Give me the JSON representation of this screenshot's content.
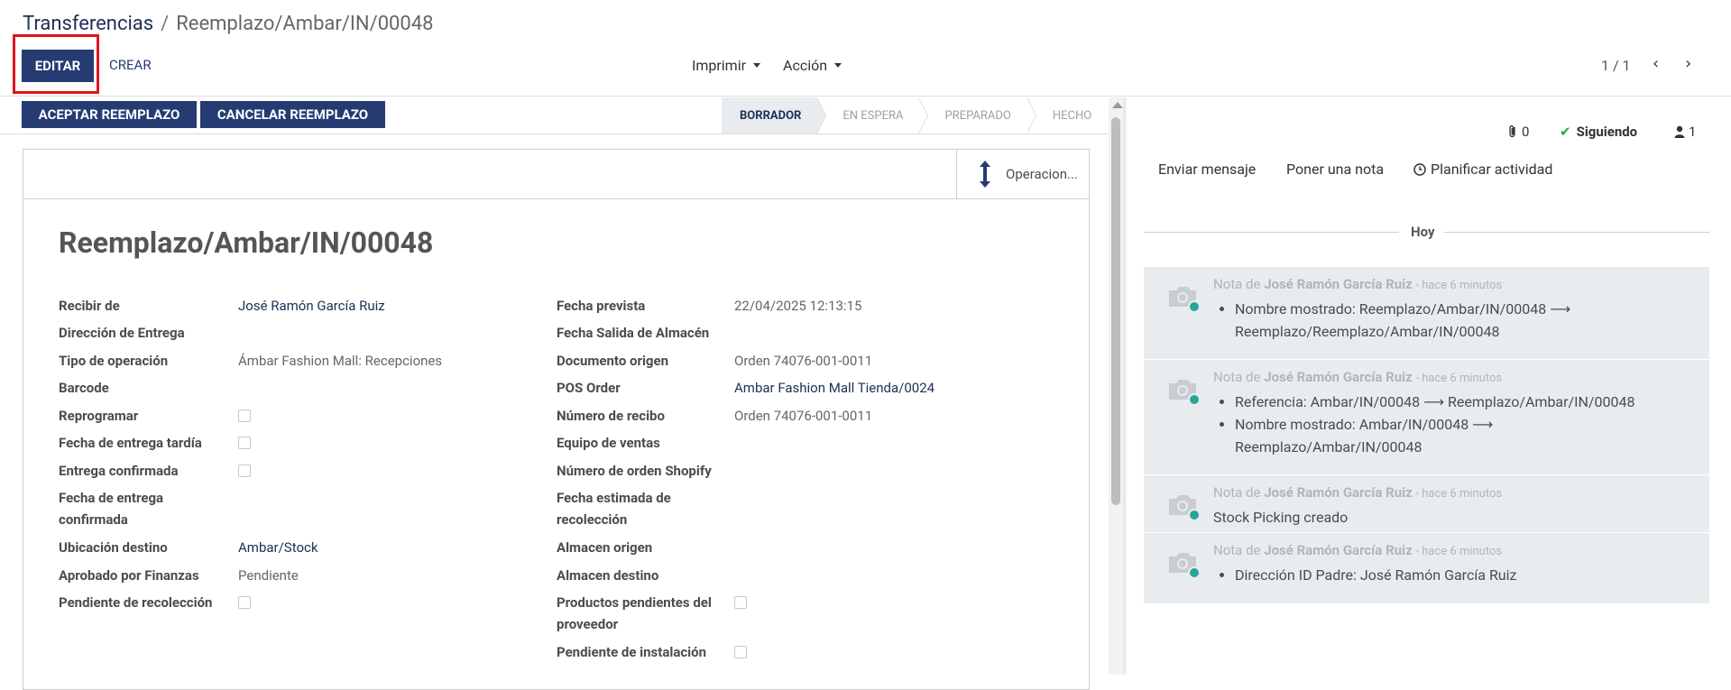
{
  "breadcrumb": {
    "parent": "Transferencias",
    "separator": "/",
    "current": "Reemplazo/Ambar/IN/00048"
  },
  "toolbar": {
    "edit": "EDITAR",
    "create": "CREAR",
    "print": "Imprimir",
    "action": "Acción",
    "pager": "1 / 1"
  },
  "header_buttons": {
    "accept": "ACEPTAR REEMPLAZO",
    "cancel": "CANCELAR REEMPLAZO"
  },
  "statusbar": [
    "BORRADOR",
    "EN ESPERA",
    "PREPARADO",
    "HECHO"
  ],
  "statusbar_active": "BORRADOR",
  "smart_button": {
    "label": "Operacion..."
  },
  "record_title": "Reemplazo/Ambar/IN/00048",
  "left_fields": [
    {
      "label": "Recibir de",
      "value": "José Ramón García Ruiz",
      "type": "link"
    },
    {
      "label": "Dirección de Entrega",
      "value": "",
      "type": "text"
    },
    {
      "label": "Tipo de operación",
      "value": "Ámbar Fashion Mall: Recepciones",
      "type": "text"
    },
    {
      "label": "Barcode",
      "value": "",
      "type": "text"
    },
    {
      "label": "Reprogramar",
      "value": "",
      "type": "checkbox"
    },
    {
      "label": "Fecha de entrega tardía",
      "value": "",
      "type": "checkbox"
    },
    {
      "label": "Entrega confirmada",
      "value": "",
      "type": "checkbox"
    },
    {
      "label": "Fecha de entrega confirmada",
      "value": "",
      "type": "text"
    },
    {
      "label": "Ubicación destino",
      "value": "Ambar/Stock",
      "type": "link"
    },
    {
      "label": "Aprobado por Finanzas",
      "value": "Pendiente",
      "type": "text"
    },
    {
      "label": "Pendiente de recolección",
      "value": "",
      "type": "checkbox"
    }
  ],
  "right_fields": [
    {
      "label": "Fecha prevista",
      "value": "22/04/2025 12:13:15",
      "type": "text"
    },
    {
      "label": "Fecha Salida de Almacén",
      "value": "",
      "type": "text"
    },
    {
      "label": "Documento origen",
      "value": "Orden 74076-001-0011",
      "type": "text"
    },
    {
      "label": "POS Order",
      "value": "Ambar Fashion Mall Tienda/0024",
      "type": "link"
    },
    {
      "label": "Número de recibo",
      "value": "Orden 74076-001-0011",
      "type": "text"
    },
    {
      "label": "Equipo de ventas",
      "value": "",
      "type": "text"
    },
    {
      "label": "Número de orden Shopify",
      "value": "",
      "type": "text"
    },
    {
      "label": "Fecha estimada de recolección",
      "value": "",
      "type": "text"
    },
    {
      "label": "Almacen origen",
      "value": "",
      "type": "text"
    },
    {
      "label": "Almacen destino",
      "value": "",
      "type": "text"
    },
    {
      "label": "Productos pendientes del proveedor",
      "value": "",
      "type": "checkbox"
    },
    {
      "label": "Pendiente de instalación",
      "value": "",
      "type": "checkbox"
    }
  ],
  "chatter": {
    "attachments": "0",
    "following": "Siguiendo",
    "followers": "1",
    "send_message": "Enviar mensaje",
    "log_note": "Poner una nota",
    "schedule": "Planificar actividad",
    "today": "Hoy",
    "messages": [
      {
        "prefix": "Nota de",
        "author": "José Ramón García Ruiz",
        "time": "- hace 6 minutos",
        "items": [
          "Nombre mostrado: Reemplazo/Ambar/IN/00048 ⟶ Reemplazo/Reemplazo/Ambar/IN/00048"
        ],
        "text": ""
      },
      {
        "prefix": "Nota de",
        "author": "José Ramón García Ruiz",
        "time": "- hace 6 minutos",
        "items": [
          "Referencia: Ambar/IN/00048 ⟶ Reemplazo/Ambar/IN/00048",
          "Nombre mostrado: Ambar/IN/00048 ⟶ Reemplazo/Ambar/IN/00048"
        ],
        "text": ""
      },
      {
        "prefix": "Nota de",
        "author": "José Ramón García Ruiz",
        "time": "- hace 6 minutos",
        "items": [],
        "text": "Stock Picking creado"
      },
      {
        "prefix": "Nota de",
        "author": "José Ramón García Ruiz",
        "time": "- hace 6 minutos",
        "items": [
          "Dirección ID Padre: José Ramón García Ruiz"
        ],
        "text": ""
      }
    ]
  },
  "colors": {
    "primary": "#253b72",
    "highlight": "#e0141c",
    "online": "#28a69a",
    "chatter_bg": "#e9ecef"
  }
}
